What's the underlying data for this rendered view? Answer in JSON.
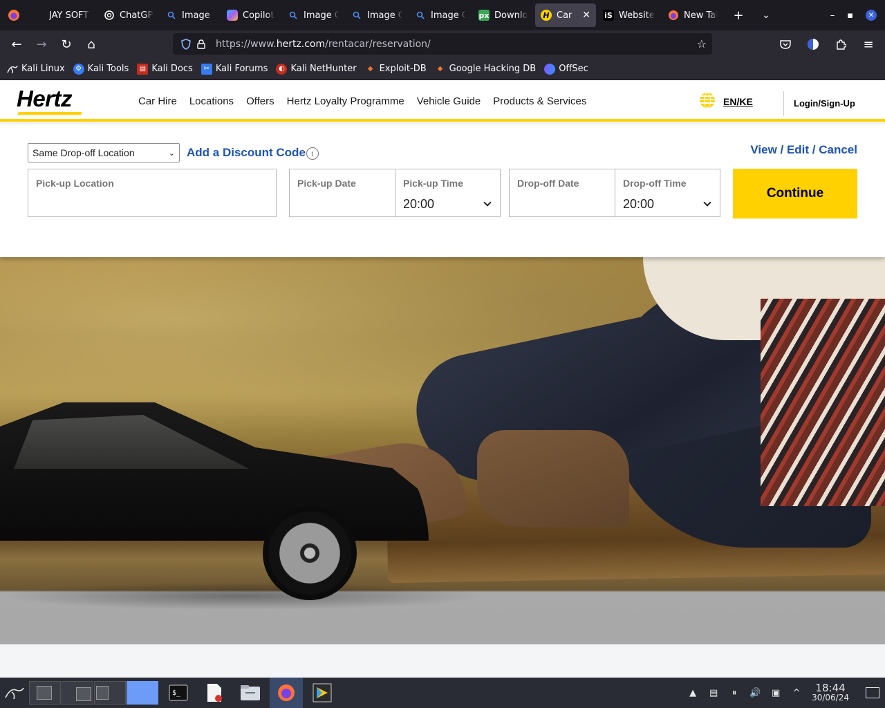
{
  "browser": {
    "tabs": [
      {
        "label": "JAY SOFT SC",
        "icon": "page-icon",
        "active": false
      },
      {
        "label": "ChatGPT",
        "icon": "chatgpt-icon",
        "active": false
      },
      {
        "label": "Image C",
        "icon": "search-icon",
        "active": false
      },
      {
        "label": "Copilot",
        "icon": "copilot-icon",
        "active": false
      },
      {
        "label": "Image C",
        "icon": "search-icon",
        "active": false
      },
      {
        "label": "Image C",
        "icon": "search-icon",
        "active": false
      },
      {
        "label": "Image C",
        "icon": "search-icon",
        "active": false
      },
      {
        "label": "Downlo",
        "icon": "px-icon",
        "active": false
      },
      {
        "label": "Car H",
        "icon": "hertz-icon",
        "active": true
      },
      {
        "label": "Website",
        "icon": "is-icon",
        "active": false
      },
      {
        "label": "New Tab",
        "icon": "firefox-icon",
        "active": false
      }
    ],
    "url": {
      "prefix": "https://www.",
      "domain": "hertz.com",
      "path": "/rentacar/reservation/"
    },
    "bookmarks": [
      {
        "label": "Kali Linux",
        "icon": "kali-icon"
      },
      {
        "label": "Kali Tools",
        "icon": "kali-tools-icon"
      },
      {
        "label": "Kali Docs",
        "icon": "kali-docs-icon"
      },
      {
        "label": "Kali Forums",
        "icon": "kali-forums-icon"
      },
      {
        "label": "Kali NetHunter",
        "icon": "nethunter-icon"
      },
      {
        "label": "Exploit-DB",
        "icon": "exploitdb-icon"
      },
      {
        "label": "Google Hacking DB",
        "icon": "ghdb-icon"
      },
      {
        "label": "OffSec",
        "icon": "offsec-icon"
      }
    ]
  },
  "site": {
    "logo_text": "Hertz",
    "nav": [
      "Car Hire",
      "Locations",
      "Offers",
      "Hertz Loyalty Programme",
      "Vehicle Guide",
      "Products & Services"
    ],
    "lang": "EN/KE",
    "login": "Login/Sign-Up"
  },
  "booking": {
    "dropoff_option": "Same Drop-off Location",
    "discount_link": "Add a Discount Code",
    "info_glyph": "i",
    "manage_link": "View / Edit / Cancel",
    "pickup_location_label": "Pick-up Location",
    "pickup_date_label": "Pick-up Date",
    "pickup_time_label": "Pick-up Time",
    "pickup_time_value": "20:00",
    "dropoff_date_label": "Drop-off Date",
    "dropoff_time_label": "Drop-off Time",
    "dropoff_time_value": "20:00",
    "continue_label": "Continue"
  },
  "taskbar": {
    "time": "18:44",
    "date": "30/06/24"
  },
  "colors": {
    "brand_yellow": "#ffd100",
    "link_blue": "#1c53b5"
  }
}
